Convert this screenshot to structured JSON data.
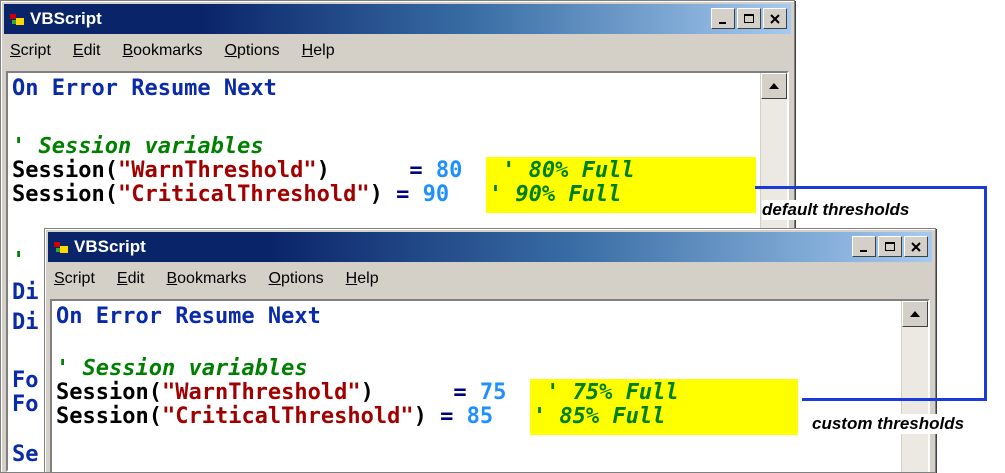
{
  "window_title": "VBScript",
  "menu": [
    "Script",
    "Edit",
    "Bookmarks",
    "Options",
    "Help"
  ],
  "back_window": {
    "lines": {
      "l1": "On Error Resume Next",
      "l2": "' Session variables",
      "warn_fn": "Session(",
      "warn_str": "\"WarnThreshold\"",
      "warn_close": ")",
      "warn_eq": "=",
      "warn_val": "80",
      "warn_cmt": "' 80% Full",
      "crit_fn": "Session(",
      "crit_str": "\"CriticalThreshold\"",
      "crit_close": ")",
      "crit_eq": "=",
      "crit_val": "90",
      "crit_cmt": "' 90% Full",
      "partial": [
        "'",
        "Di",
        "Di",
        "Fo",
        "Fo",
        "Se"
      ]
    }
  },
  "front_window": {
    "lines": {
      "l1": "On Error Resume Next",
      "l2": "' Session variables",
      "warn_fn": "Session(",
      "warn_str": "\"WarnThreshold\"",
      "warn_close": ")",
      "warn_eq": "=",
      "warn_val": "75",
      "warn_cmt": "' 75% Full",
      "crit_fn": "Session(",
      "crit_str": "\"CriticalThreshold\"",
      "crit_close": ")",
      "crit_eq": "=",
      "crit_val": "85",
      "crit_cmt": "' 85% Full"
    }
  },
  "annotations": {
    "default_label": "default thresholds",
    "custom_label": "custom thresholds"
  },
  "colors": {
    "keyword": "#0a2aa8",
    "comment": "#008000",
    "string": "#a00000",
    "number": "#1e90ff",
    "highlight": "#ffff00",
    "connector": "#1a3bd8"
  },
  "icons": [
    "app-icon",
    "minimize-icon",
    "maximize-icon",
    "close-icon",
    "scroll-up-arrow-icon"
  ]
}
